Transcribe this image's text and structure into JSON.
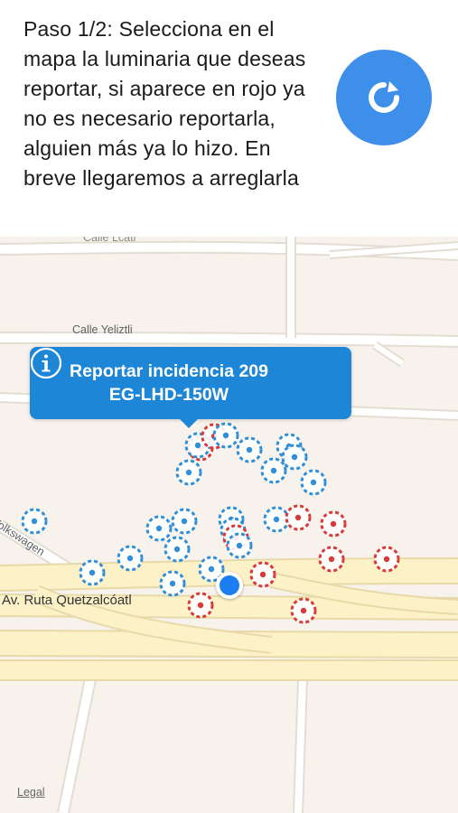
{
  "header": {
    "instructions": "Paso 1/2: Selecciona en el mapa la luminaria que deseas reportar, si aparece en rojo ya no es necesario reportarla, alguien más ya lo hizo. En breve llegaremos a arreglarla",
    "refresh_icon": "refresh-icon",
    "accent_color": "#3d8fea"
  },
  "map": {
    "streets": {
      "top_partial": "Calle Lcatl",
      "yeliztli": "Calle Yeliztli",
      "volkswagen": "Volkswagen",
      "quetzalcoatl": "Av. Ruta Quetzalcóatl"
    },
    "callout": {
      "line1": "Reportar incidencia 209",
      "line2": "EG-LHD-150W",
      "info_icon": "info-icon",
      "color": "#1d86d6"
    },
    "legal": "Legal",
    "marker_colors": {
      "available": "#2f8fd8",
      "reported": "#d83a3a"
    }
  }
}
